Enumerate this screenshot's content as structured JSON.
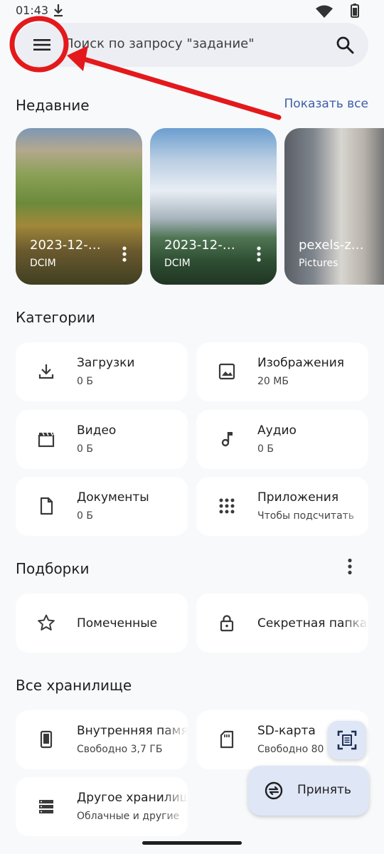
{
  "status_bar": {
    "time": "01:43"
  },
  "search": {
    "placeholder": "Поиск по запросу \"задание\""
  },
  "recent": {
    "title": "Недавние",
    "show_all": "Показать все",
    "items": [
      {
        "name": "2023-12-…",
        "folder": "DCIM"
      },
      {
        "name": "2023-12-…",
        "folder": "DCIM"
      },
      {
        "name": "pexels-z…",
        "folder": "Pictures"
      }
    ]
  },
  "categories": {
    "title": "Категории",
    "items": [
      {
        "label": "Загрузки",
        "sub": "0 Б",
        "icon": "download-icon"
      },
      {
        "label": "Изображения",
        "sub": "20 МБ",
        "icon": "image-icon"
      },
      {
        "label": "Видео",
        "sub": "0 Б",
        "icon": "video-icon"
      },
      {
        "label": "Аудио",
        "sub": "0 Б",
        "icon": "music-note-icon"
      },
      {
        "label": "Документы",
        "sub": "0 Б",
        "icon": "document-icon"
      },
      {
        "label": "Приложения",
        "sub": "Чтобы подсчитать",
        "icon": "apps-grid-icon"
      }
    ]
  },
  "collections": {
    "title": "Подборки",
    "items": [
      {
        "label": "Помеченные",
        "icon": "star-icon"
      },
      {
        "label": "Секретная папка",
        "icon": "lock-icon"
      }
    ]
  },
  "storage": {
    "title": "Все хранилище",
    "items": [
      {
        "label": "Внутренняя память",
        "sub": "Свободно 3,7 ГБ",
        "icon": "phone-icon"
      },
      {
        "label": "SD-карта",
        "sub": "Свободно 80",
        "icon": "sd-card-icon"
      },
      {
        "label": "Другое хранилище",
        "sub": "Облачные и другие",
        "icon": "storage-icon"
      }
    ]
  },
  "fab": {
    "accept_label": "Принять"
  },
  "colors": {
    "accent": "#3d5da8",
    "annotation": "#e3191c",
    "card": "#ffffff",
    "background": "#f8f9fb",
    "fab": "#dfe6f6"
  }
}
